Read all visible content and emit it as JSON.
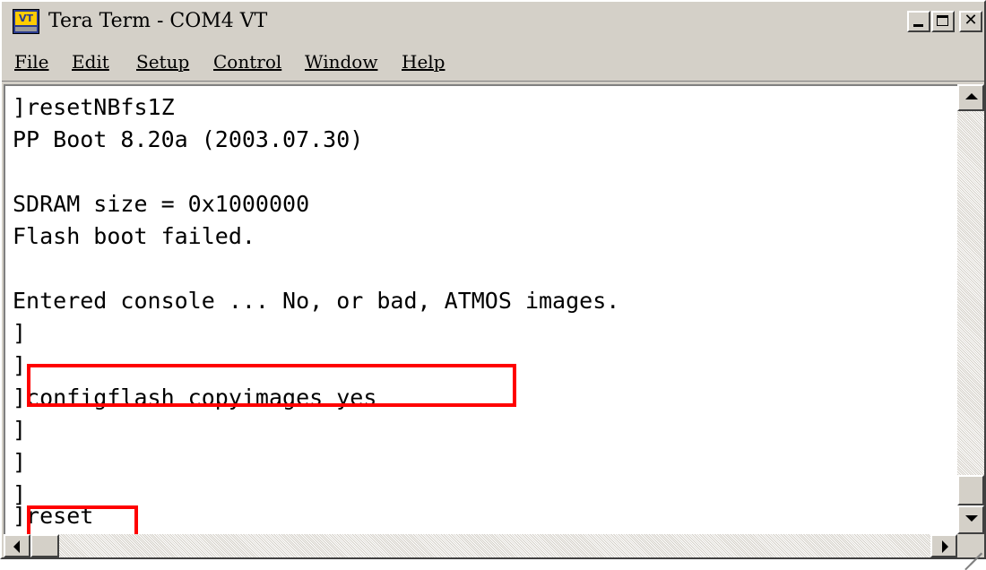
{
  "window": {
    "title": "Tera Term - COM4 VT",
    "app_icon": "teraterm-app-icon",
    "icon_text": "VT"
  },
  "menu": [
    {
      "label": "File"
    },
    {
      "label": "Edit"
    },
    {
      "label": "Setup"
    },
    {
      "label": "Control"
    },
    {
      "label": "Window"
    },
    {
      "label": "Help"
    }
  ],
  "terminal": {
    "lines": [
      "]resetNBfs1Z",
      "PP Boot 8.20a (2003.07.30)",
      "",
      "SDRAM size = 0x1000000",
      "Flash boot failed.",
      "",
      "Entered console ... No, or bad, ATMOS images.",
      "]",
      "]",
      "]configflash copyimages yes",
      "]",
      "]",
      "]",
      "]reset"
    ],
    "highlight_color": "#ff0000",
    "highlighted_commands": [
      "configflash copyimages yes",
      "reset"
    ]
  },
  "controls": {
    "minimize_icon": "minimize-icon",
    "maximize_icon": "maximize-icon",
    "close_icon": "close-icon",
    "close_glyph": "✕"
  }
}
